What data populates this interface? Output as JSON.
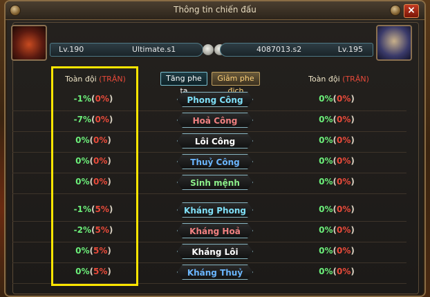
{
  "window": {
    "title": "Thông tin chiến đấu",
    "close_label": "×"
  },
  "player_left": {
    "level": "Lv.190",
    "name": "Ultimate.s1"
  },
  "player_right": {
    "level": "Lv.195",
    "name": "4087013.s2"
  },
  "columns": {
    "left_head": "Toàn đội",
    "left_tag": "(TRẬN)",
    "right_head": "Toàn đội",
    "right_tag": "(TRẬN)"
  },
  "toggles": {
    "us": "Tăng phe ta",
    "enemy": "Giảm phe địch"
  },
  "rows": [
    {
      "label": "Phong Công",
      "left": "-1%",
      "left_tran": "0%",
      "right": "0%",
      "right_tran": "0%"
    },
    {
      "label": "Hoả Công",
      "left": "-7%",
      "left_tran": "0%",
      "right": "0%",
      "right_tran": "0%"
    },
    {
      "label": "Lôi Công",
      "left": "0%",
      "left_tran": "0%",
      "right": "0%",
      "right_tran": "0%"
    },
    {
      "label": "Thuỷ Công",
      "left": "0%",
      "left_tran": "0%",
      "right": "0%",
      "right_tran": "0%"
    },
    {
      "label": "Sinh mệnh",
      "left": "0%",
      "left_tran": "0%",
      "right": "0%",
      "right_tran": "0%"
    },
    {
      "label": "Kháng Phong",
      "left": "-1%",
      "left_tran": "5%",
      "right": "0%",
      "right_tran": "0%"
    },
    {
      "label": "Kháng Hoả",
      "left": "-2%",
      "left_tran": "5%",
      "right": "0%",
      "right_tran": "0%"
    },
    {
      "label": "Kháng Lôi",
      "left": "0%",
      "left_tran": "5%",
      "right": "0%",
      "right_tran": "0%"
    },
    {
      "label": "Kháng Thuỷ",
      "left": "0%",
      "left_tran": "5%",
      "right": "0%",
      "right_tran": "0%"
    }
  ],
  "colors": {
    "highlight_box": "#ffe600",
    "positive": "#6cf07a",
    "tran": "#e84a3a"
  }
}
